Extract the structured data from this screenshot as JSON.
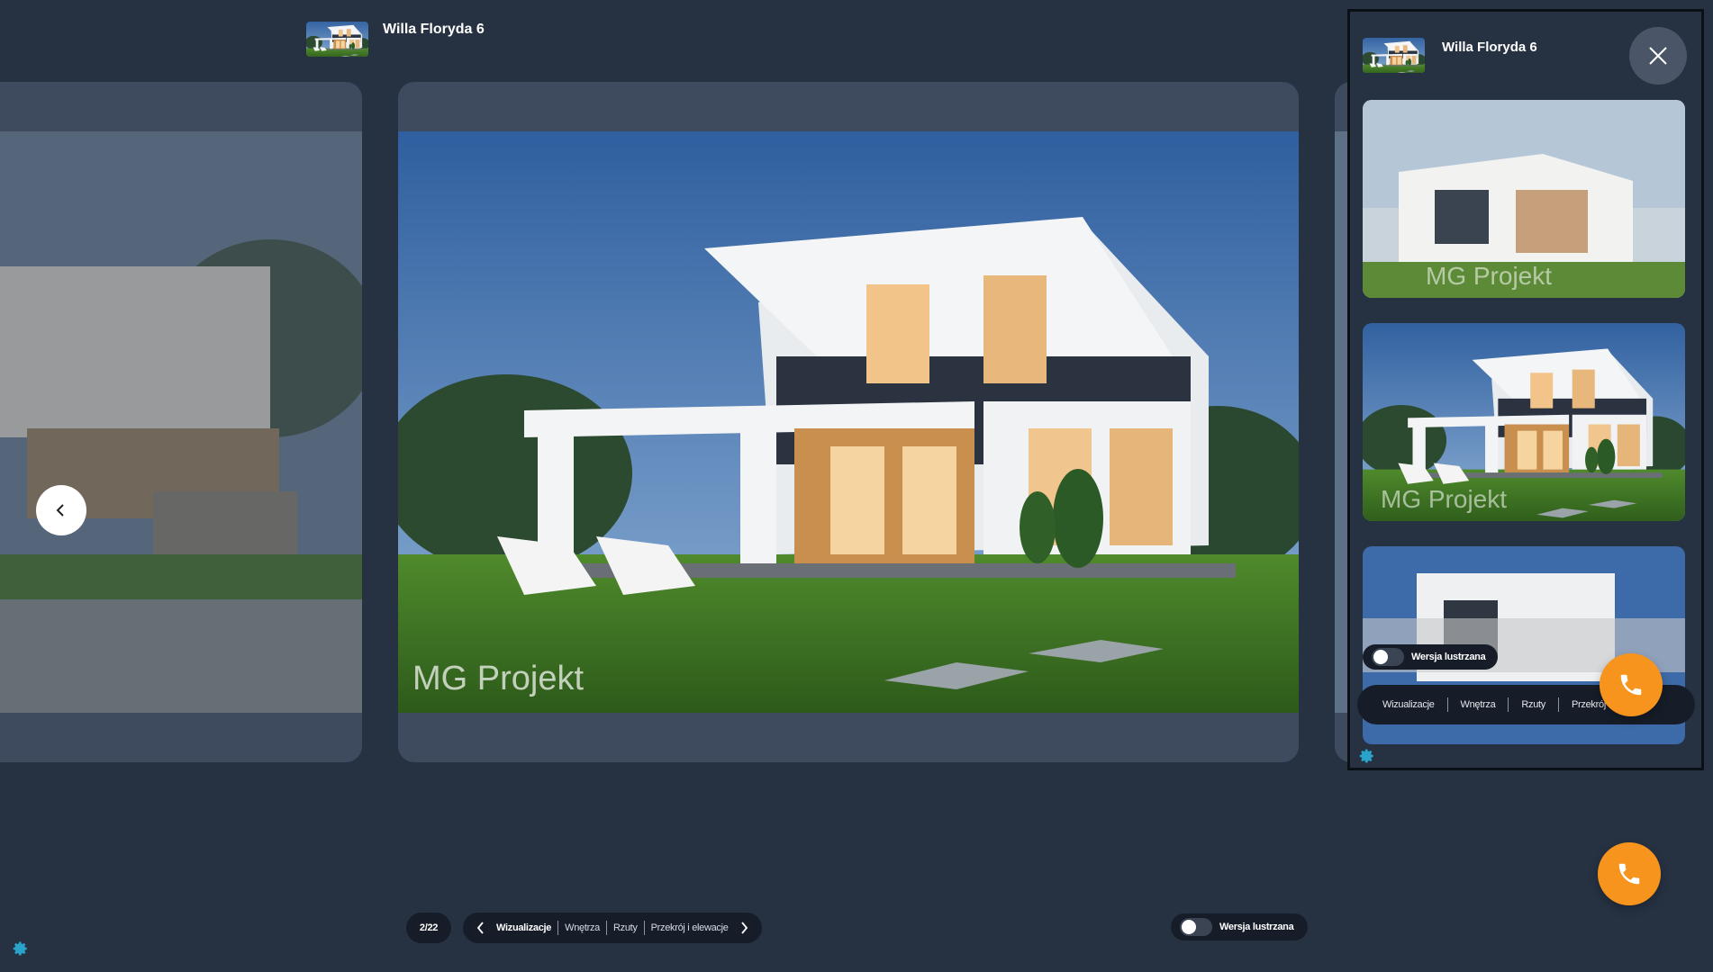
{
  "header": {
    "title": "Willa Floryda 6"
  },
  "slider": {
    "counter": "2/22",
    "watermark": "MG Projekt",
    "categories": [
      "Wizualizacje",
      "Wnętrza",
      "Rzuty",
      "Przekrój i elewacje"
    ],
    "active_category": "Wizualizacje",
    "mirror_label": "Wersja lustrzana"
  },
  "panel": {
    "title": "Willa Floryda 6",
    "mirror_label": "Wersja lustrzana",
    "categories": [
      "Wizualizacje",
      "Wnętrza",
      "Rzuty",
      "Przekrój i elewacje"
    ],
    "watermark": "MG Projekt"
  },
  "colors": {
    "background": "#263142",
    "card": "#3e4b5f",
    "accent_phone": "#f7941d",
    "pill": "#161d28",
    "gear": "#29a3c9"
  },
  "icons": [
    "chevron-left-icon",
    "chevron-right-icon",
    "close-icon",
    "phone-icon",
    "gear-icon"
  ]
}
